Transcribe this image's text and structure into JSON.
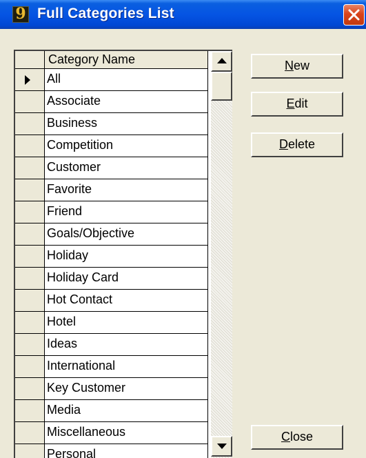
{
  "window": {
    "title": "Full Categories List",
    "app_icon_glyph": "9"
  },
  "grid": {
    "column_header": "Category Name",
    "selected_index": 0,
    "rows": [
      "All",
      "Associate",
      "Business",
      "Competition",
      "Customer",
      "Favorite",
      "Friend",
      "Goals/Objective",
      "Holiday",
      "Holiday Card",
      "Hot Contact",
      "Hotel",
      "Ideas",
      "International",
      "Key Customer",
      "Media",
      "Miscellaneous",
      "Personal"
    ]
  },
  "buttons": {
    "new": {
      "mnemonic": "N",
      "rest": "ew"
    },
    "edit": {
      "mnemonic": "E",
      "rest": "dit"
    },
    "delete": {
      "mnemonic": "D",
      "rest": "elete"
    },
    "close": {
      "mnemonic": "C",
      "rest": "lose"
    }
  },
  "colors": {
    "titlebar": "#0554e3",
    "close_button": "#d9431b",
    "face": "#ece9d8"
  },
  "icons": {
    "app": "app-logo-icon",
    "close": "close-x-icon",
    "row_pointer": "row-pointer-icon",
    "scroll_up": "scroll-up-arrow-icon",
    "scroll_down": "scroll-down-arrow-icon"
  }
}
